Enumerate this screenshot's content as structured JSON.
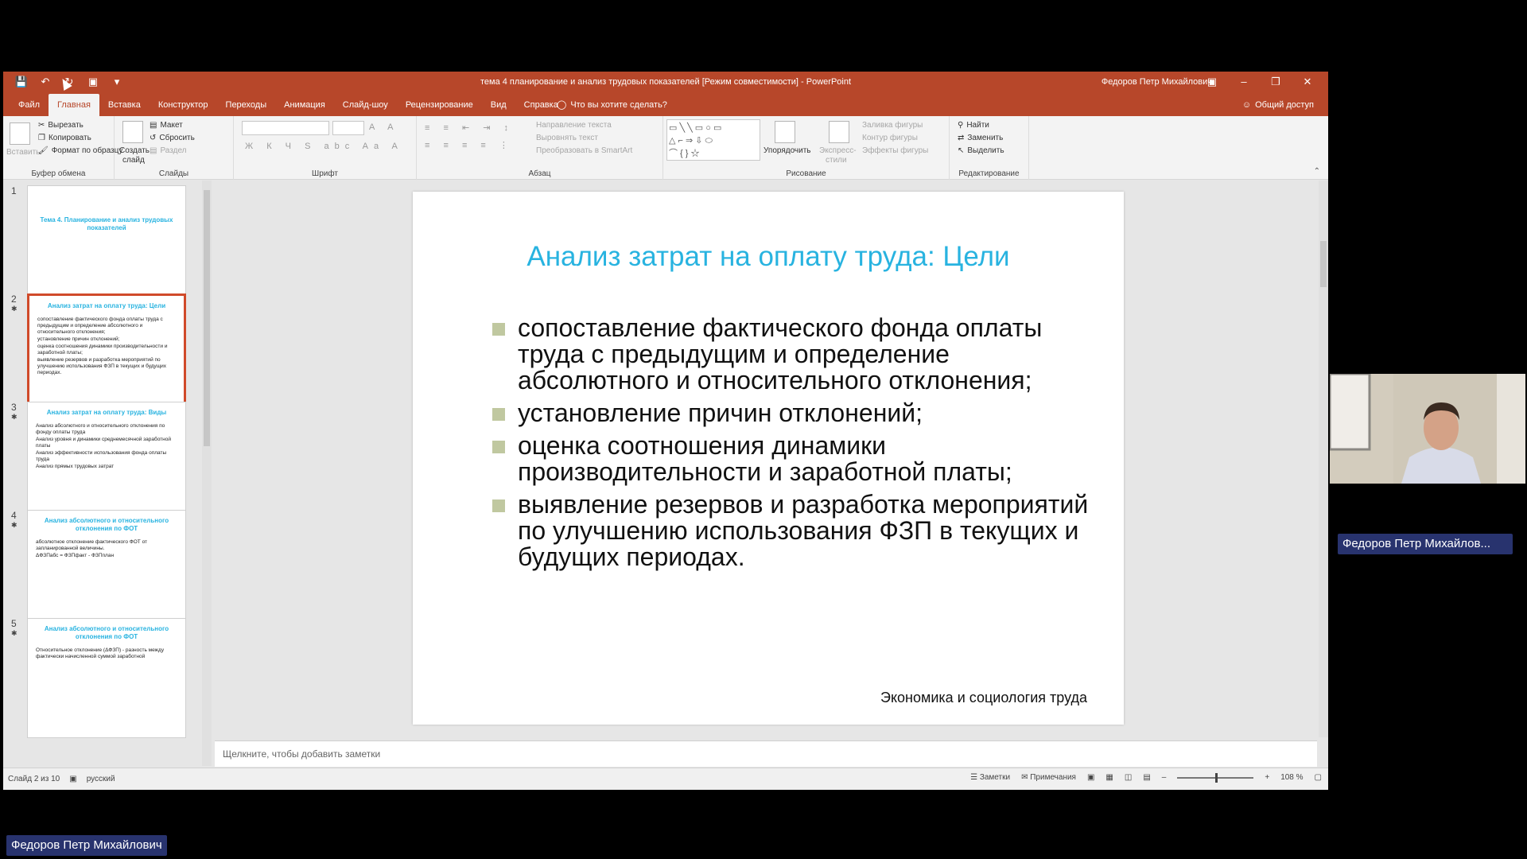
{
  "window": {
    "doc_title": "тема 4 планирование и анализ трудовых показателей [Режим совместимости] - PowerPoint",
    "user_name": "Федоров Петр Михайлович",
    "tabs": [
      {
        "label": "Файл"
      },
      {
        "label": "Главная",
        "active": true
      },
      {
        "label": "Вставка"
      },
      {
        "label": "Конструктор"
      },
      {
        "label": "Переходы"
      },
      {
        "label": "Анимация"
      },
      {
        "label": "Слайд-шоу"
      },
      {
        "label": "Рецензирование"
      },
      {
        "label": "Вид"
      },
      {
        "label": "Справка"
      }
    ],
    "tell_me": "Что вы хотите сделать?",
    "share": "Общий доступ"
  },
  "ribbon": {
    "clipboard": {
      "label": "Буфер обмена",
      "paste": "Вставить",
      "cut": "Вырезать",
      "copy": "Копировать",
      "format_painter": "Формат по образцу"
    },
    "slides": {
      "label": "Слайды",
      "new_slide_1": "Создать",
      "new_slide_2": "слайд",
      "layout": "Макет",
      "reset": "Сбросить",
      "section": "Раздел"
    },
    "font": {
      "label": "Шрифт"
    },
    "paragraph": {
      "label": "Абзац",
      "text_direction": "Направление текста",
      "align_text": "Выровнять текст",
      "smartart": "Преобразовать в SmartArt"
    },
    "drawing": {
      "label": "Рисование",
      "arrange": "Упорядочить",
      "quick_styles_1": "Экспресс-",
      "quick_styles_2": "стили",
      "shape_fill": "Заливка фигуры",
      "shape_outline": "Контур фигуры",
      "shape_effects": "Эффекты фигуры"
    },
    "editing": {
      "label": "Редактирование",
      "find": "Найти",
      "replace": "Заменить",
      "select": "Выделить"
    }
  },
  "thumbnails": [
    {
      "num": "1",
      "star": "",
      "title": "Тема 4. Планирование и анализ трудовых показателей",
      "lines": [],
      "selected": false
    },
    {
      "num": "2",
      "star": "✱",
      "title": "Анализ затрат на оплату труда: Цели",
      "lines": [
        "сопоставление фактического фонда оплаты труда с предыдущим и определение абсолютного и относительного отклонения;",
        "установление причин отклонений;",
        "оценка соотношения динамики производительности и заработной платы;",
        "выявление резервов и разработка мероприятий по улучшению использования ФЗП в текущих и будущих периодах."
      ],
      "selected": true
    },
    {
      "num": "3",
      "star": "✱",
      "title": "Анализ затрат на оплату труда: Виды",
      "lines": [
        "Анализ абсолютного и относительного отклонения по фонду оплаты труда",
        "Анализ уровня и динамики среднемесячной заработной платы",
        "Анализ эффективности использования фонда оплаты труда",
        "Анализ прямых трудовых затрат"
      ],
      "selected": false
    },
    {
      "num": "4",
      "star": "✱",
      "title": "Анализ абсолютного и относительного отклонения по ФОТ",
      "lines": [
        "абсолютное отклонение фактического ФОТ от запланированной величины.",
        "ΔФЗПабс = ФЗПфакт - ФЗПплан"
      ],
      "selected": false
    },
    {
      "num": "5",
      "star": "✱",
      "title": "Анализ абсолютного и относительного отклонения по ФОТ",
      "lines": [
        "Относительное отклонение (ΔФЗП) - разность между фактически начисленной суммой заработной"
      ],
      "selected": false
    }
  ],
  "slide": {
    "title": "Анализ затрат на оплату труда:  Цели",
    "bullets": [
      "сопоставление фактического фонда оплаты труда с предыдущим и определение абсолютного и относительного отклонения;",
      "установление причин отклонений;",
      "оценка соотношения динамики производительности и заработной платы;",
      "выявление резервов и разработка мероприятий по улучшению использования ФЗП в текущих и будущих периодах."
    ],
    "footer": "Экономика и социология труда"
  },
  "notes_placeholder": "Щелкните, чтобы добавить заметки",
  "status": {
    "slide_count": "Слайд 2 из 10",
    "language": "русский",
    "notes": "Заметки",
    "comments": "Примечания",
    "zoom": "108 %"
  },
  "conference": {
    "presenter_tile_label": "Федоров Петр Михайлов...",
    "bottom_label": "Федоров Петр Михайлович"
  },
  "colors": {
    "ribbon_accent": "#b7472a",
    "slide_title": "#28b3e0",
    "bullet_square": "#c0c8a0",
    "name_label_bg": "#28336e"
  }
}
